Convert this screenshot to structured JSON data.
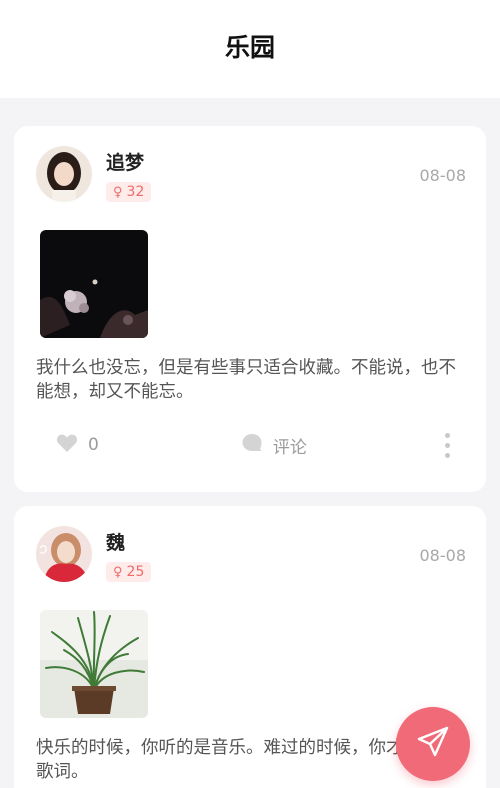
{
  "header": {
    "title": "乐园"
  },
  "posts": [
    {
      "username": "追梦",
      "gender_symbol": "♀",
      "age": "32",
      "date": "08-08",
      "content": "我什么也没忘，但是有些事只适合收藏。不能说，也不能想，却又不能忘。",
      "like_count": "0",
      "comment_label": "评论"
    },
    {
      "username": "魏",
      "gender_symbol": "♀",
      "age": "25",
      "date": "08-08",
      "content": "快乐的时候，你听的是音乐。难过的时候，你才懂得了歌词。"
    }
  ],
  "colors": {
    "accent": "#f06a78",
    "badge_bg": "#fdecea",
    "badge_text": "#ef6a6a",
    "muted": "#a8a8a8"
  },
  "icons": {
    "like": "heart-icon",
    "comment": "speech-bubble-icon",
    "more": "vertical-dots-icon",
    "fab": "paper-plane-icon"
  }
}
